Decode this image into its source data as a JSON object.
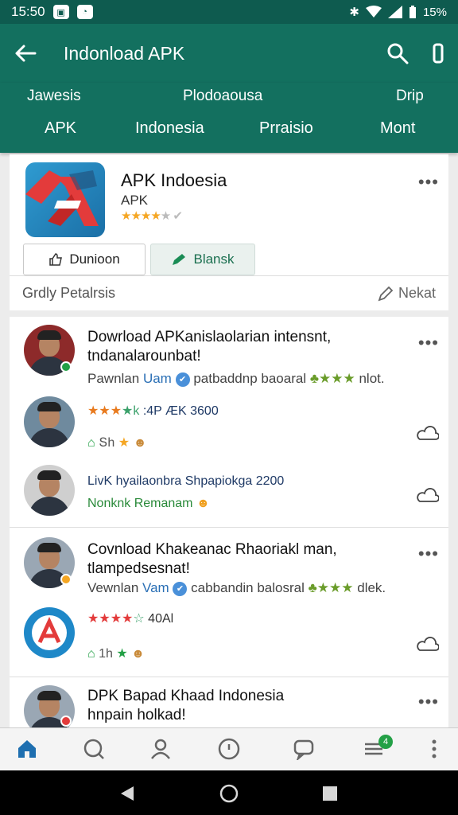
{
  "status_bar": {
    "time": "15:50",
    "battery": "15%"
  },
  "app_bar": {
    "title": "Indonload APK"
  },
  "tabs": {
    "row1": [
      "Jawesis",
      "Plodoaousa",
      "Drip"
    ],
    "row2": [
      "APK",
      "Indonesia",
      "Prraisio",
      "Mont"
    ]
  },
  "app": {
    "name": "APK Indoesia",
    "subtitle": "APK",
    "rating_stars": 3.5,
    "download_label": "Dunioon",
    "share_label": "Blansk"
  },
  "section": {
    "title": "Grdly Petalrsis",
    "next_label": "Nekat"
  },
  "posts": [
    {
      "title_line1": "Dowrload APKanislaolarian intensnt,",
      "title_line2": "tndanalarounbat!",
      "meta_prefix": "Pawnlan ",
      "meta_name": "Uam",
      "meta_suffix": "patbaddnp baoaral ",
      "meta_tail": " nlot.",
      "reply1_rating": "ÆK 3600",
      "reply1_prefix": "★★★½k :4P",
      "reply1_reactions": "Տh",
      "reply2_line1": "LivK hyailaonbra Shpapiokga 2200",
      "reply2_line2": "Nonknk Remanam"
    },
    {
      "title_line1": "Covnload Khakeanac Rhaoriakl man,",
      "title_line2": "tlampedsesnat!",
      "meta_prefix": "Vewnlan ",
      "meta_name": "Vam",
      "meta_suffix": "cabbandin balosral ",
      "meta_tail": " dlek.",
      "reply1_rating": "40Al",
      "reply1_reactions": "1h"
    },
    {
      "title_line1": "DPK Bapad Khaad Indonesia",
      "title_line2": "hnpain holkad!"
    }
  ],
  "bottom_nav": {
    "badge_count": "4"
  },
  "colors": {
    "primary": "#13705f",
    "primary_dark": "#0e5b4f",
    "accent_green": "#23a046",
    "star": "#f5a623"
  }
}
